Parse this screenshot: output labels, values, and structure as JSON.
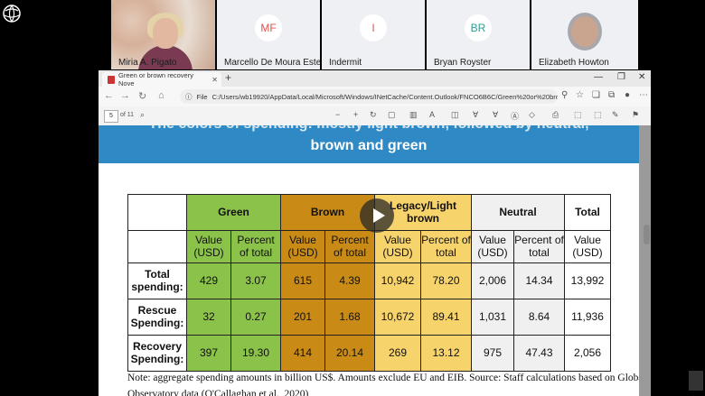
{
  "participants": [
    {
      "name": "Miria A. Pigato",
      "initials": ""
    },
    {
      "name": "Marcello De Moura Este",
      "initials": "MF",
      "color": "#d9534f"
    },
    {
      "name": "Indermit",
      "initials": "I",
      "color": "#d9534f"
    },
    {
      "name": "Bryan Royster",
      "initials": "BR",
      "color": "#2a9d8f"
    },
    {
      "name": "Elizabeth Howton",
      "initials": ""
    }
  ],
  "browser": {
    "tab_title": "Green or brown recovery Nove",
    "url_prefix": "File",
    "url": "C:/Users/wb19920/AppData/Local/Microsoft/Windows/INetCache/Content.Outlook/FNCO6B6C/Green%20or%20brow...",
    "page_current": "5",
    "page_total": "of 11"
  },
  "slide": {
    "title_line1": "The colors of spending: mostly light brown, followed by neutral,",
    "title_line2": "brown and green",
    "note_line1": "Note: aggregate spending amounts in billion US$. Amounts exclude EU and EIB. Source: Staff calculations based on Global Recovery",
    "note_line2": "Observatory data (O'Callaghan et al., 2020)"
  },
  "table": {
    "groups": [
      "Green",
      "Brown",
      "Legacy/Light brown",
      "Neutral",
      "Total"
    ],
    "sub_value": "Value (USD)",
    "sub_percent": "Percent of total",
    "rows": [
      {
        "label": "Total spending:",
        "vals": [
          "429",
          "3.07",
          "615",
          "4.39",
          "10,942",
          "78.20",
          "2,006",
          "14.34",
          "13,992"
        ]
      },
      {
        "label": "Rescue Spending:",
        "vals": [
          "32",
          "0.27",
          "201",
          "1.68",
          "10,672",
          "89.41",
          "1,031",
          "8.64",
          "11,936"
        ]
      },
      {
        "label": "Recovery Spending:",
        "vals": [
          "397",
          "19.30",
          "414",
          "20.14",
          "269",
          "13.12",
          "975",
          "47.43",
          "2,056"
        ]
      }
    ]
  },
  "colors": {
    "green": "#8bc24a",
    "brown": "#c98b16",
    "legacy": "#f7d36b",
    "neutral": "#f0f0f0",
    "banner": "#2e89c4"
  }
}
